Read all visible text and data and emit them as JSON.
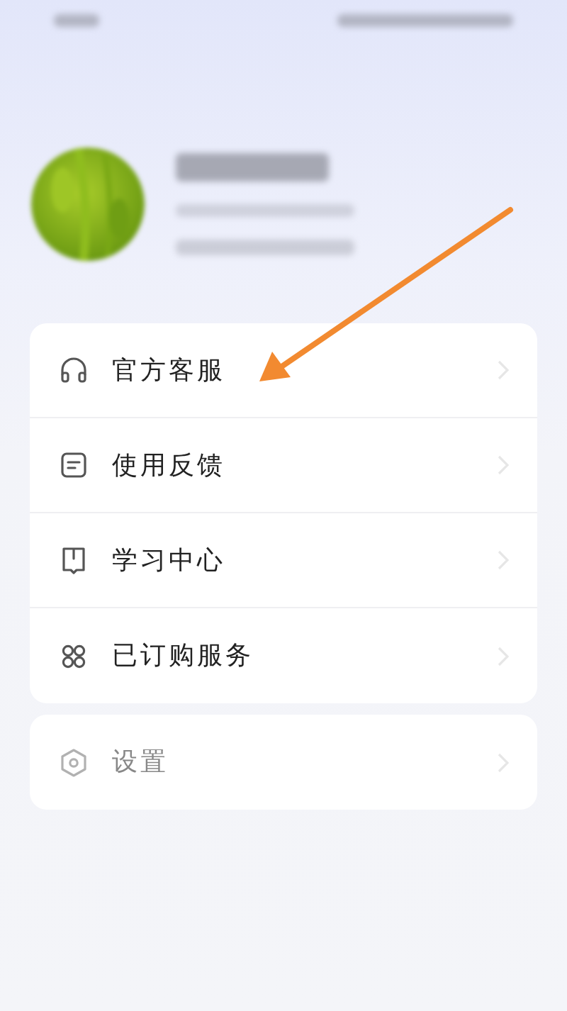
{
  "menu_groups": [
    {
      "items": [
        {
          "kind": "headset",
          "label": "官方客服",
          "disabled": false
        },
        {
          "kind": "note",
          "label": "使用反馈",
          "disabled": false
        },
        {
          "kind": "book",
          "label": "学习中心",
          "disabled": false
        },
        {
          "kind": "grid",
          "label": "已订购服务",
          "disabled": false
        }
      ]
    },
    {
      "items": [
        {
          "kind": "gear",
          "label": "设置",
          "disabled": true
        }
      ]
    }
  ]
}
